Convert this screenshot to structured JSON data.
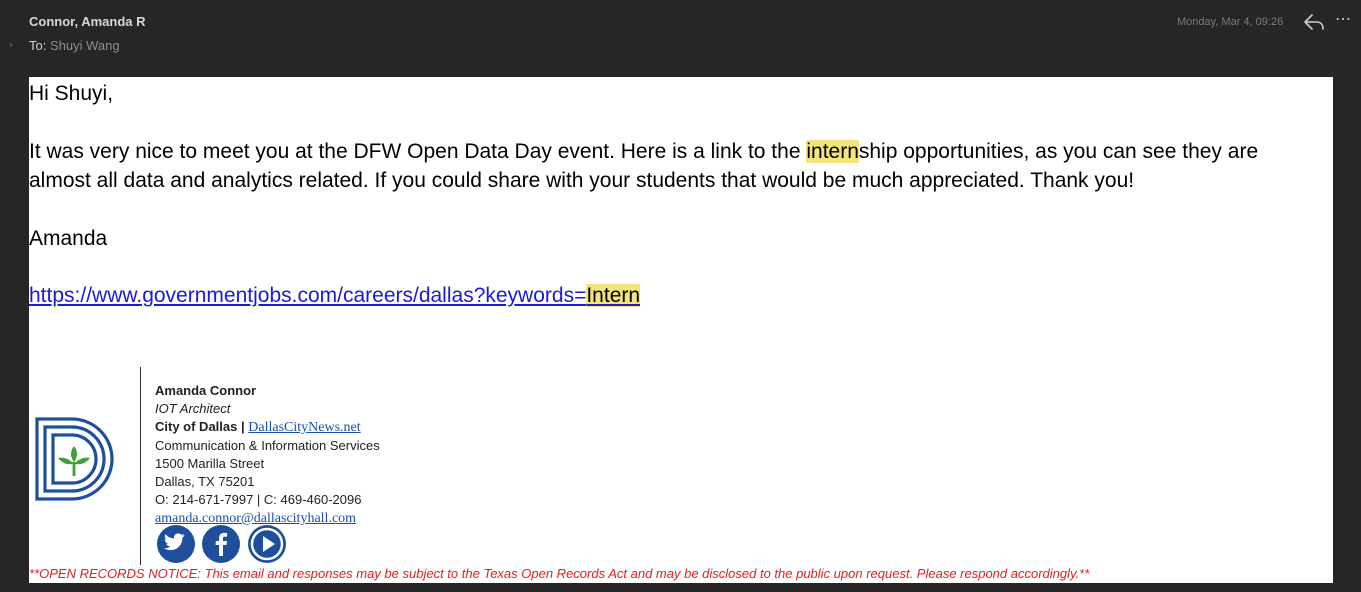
{
  "header": {
    "from": "Connor, Amanda R",
    "to_label": "To:",
    "to_value": "Shuyi Wang",
    "date": "Monday, Mar 4, 09:26",
    "expand_icon": "chevron-right-icon",
    "reply_icon": "reply-icon",
    "more_icon": "more-icon"
  },
  "body": {
    "greeting": "Hi Shuyi,",
    "para1_a": "It was very nice to meet you at the DFW Open Data Day event. Here is a link to the ",
    "para1_hl": "intern",
    "para1_b": "ship opportunities, as you can see they are",
    "para2": "almost all data and analytics related. If you could share with your students that would be much appreciated. Thank you!",
    "signoff": "Amanda",
    "link_prefix": "https://www.governmentjobs.com/careers/dallas?keywords=",
    "link_hl": "Intern",
    "highlight_color": "#f3e57c",
    "link_color": "#1a1bd6"
  },
  "signature": {
    "name": "Amanda Connor",
    "title": "IOT Architect",
    "org": "City of Dallas",
    "org_sep": "|",
    "org_link": "DallasCityNews.net",
    "dept": "Communication & Information Services",
    "street": "1500 Marilla Street",
    "city": "Dallas, TX 75201",
    "phones": "O:  214-671-7997 |  C: 469-460-2096",
    "email": "amanda.connor@dallascityhall.com",
    "logo_icon": "city-of-dallas-logo",
    "social_icons": [
      "twitter-icon",
      "facebook-icon",
      "play-icon"
    ],
    "brand_color": "#1d4f9c"
  },
  "notice": "**OPEN RECORDS NOTICE: This email and responses may be subject to the Texas Open Records Act and may be disclosed to the public upon request.  Please respond accordingly.**"
}
